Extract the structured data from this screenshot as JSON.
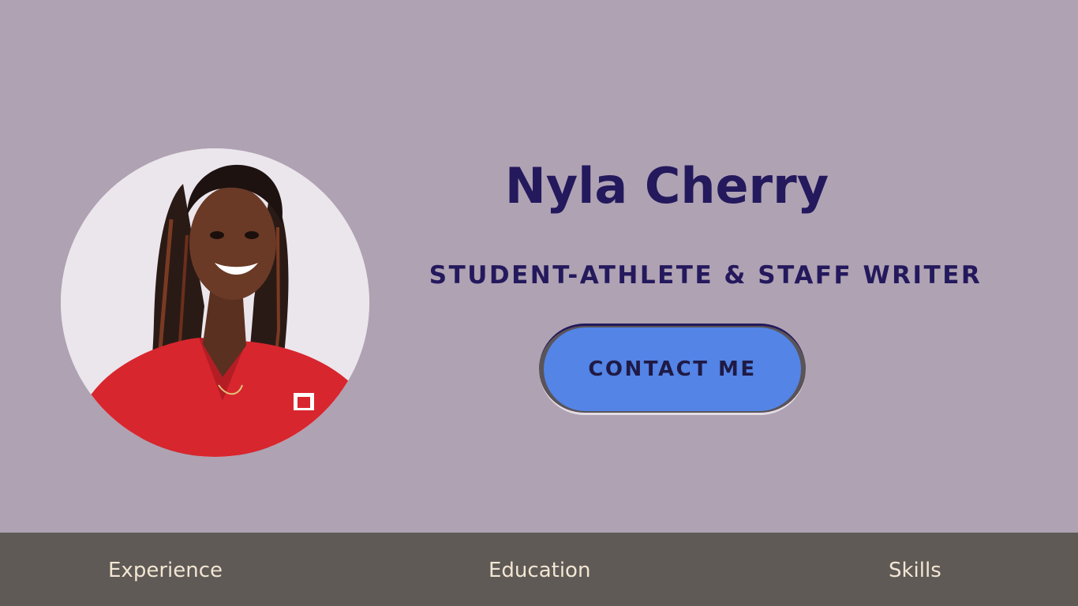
{
  "profile": {
    "name": "Nyla Cherry",
    "subtitle": "STUDENT-ATHLETE & STAFF WRITER",
    "photo_icon": "profile-photo",
    "contact_label": "CONTACT ME"
  },
  "nav": {
    "items": [
      {
        "label": "Experience"
      },
      {
        "label": "Education"
      },
      {
        "label": "Skills"
      }
    ]
  },
  "colors": {
    "background": "#afa2b3",
    "heading": "#24195c",
    "button": "#5384e6",
    "footer": "#5f5a56",
    "footer_text": "#f2e6d3"
  }
}
